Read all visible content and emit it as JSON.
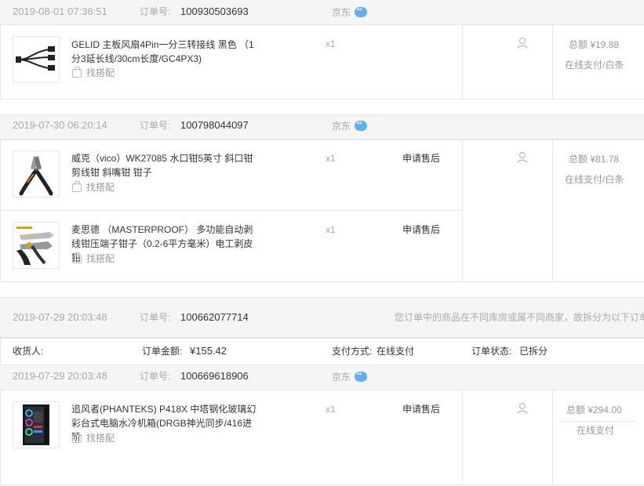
{
  "orders": [
    {
      "date": "2019-08-01 07:36:51",
      "order_no_label": "订单号:",
      "order_no": "100930503693",
      "shop": "京东",
      "total": "总额 ¥19.88",
      "pay": "在线支付/白条",
      "items": [
        {
          "title": "GELID 主板风扇4Pin一分三转接线 黑色 （1分3延长线/30cm长度/GC4PX3)",
          "qty": "x1",
          "find": "找搭配",
          "after_sale": ""
        }
      ]
    },
    {
      "date": "2019-07-30 06:20:14",
      "order_no_label": "订单号:",
      "order_no": "100798044097",
      "shop": "京东",
      "total": "总额 ¥81.78",
      "pay": "在线支付/白条",
      "items": [
        {
          "title": "威克（vico）WK27085 水口钳5英寸 斜口钳 剪线钳 斜嘴钳 钳子",
          "qty": "x1",
          "find": "找搭配",
          "after_sale": "申请售后"
        },
        {
          "title": "麦思德 （MASTERPROOF） 多功能自动剥线钳压端子钳子（0.2-6平方毫米）电工剥皮钳",
          "qty": "x1",
          "find": "找搭配",
          "after_sale": "申请售后"
        }
      ]
    }
  ],
  "split_order": {
    "date": "2019-07-29 20:03:48",
    "order_no_label": "订单号:",
    "order_no": "100662077714",
    "notice": "您订单中的商品在不同库房或属不同商家，故拆分为以下订单",
    "receiver_label": "收货人:",
    "amount_label": "订单金额:",
    "amount": "¥155.42",
    "pay_label": "支付方式:",
    "pay_value": "在线支付",
    "status_label": "订单状态:",
    "status_value": "已拆分",
    "sub": {
      "date": "2019-07-29 20:03:48",
      "order_no_label": "订单号:",
      "order_no": "100669618906",
      "shop": "京东",
      "total": "总额 ¥294.00",
      "pay": "在线支付",
      "items": [
        {
          "title": "追风者(PHANTEKS) P418X 中塔钢化玻璃幻彩台式电脑水冷机箱(DRGB神光同步/416进阶",
          "qty": "x1",
          "find": "找搭配",
          "after_sale": "申请售后"
        }
      ]
    }
  },
  "colors": {
    "header_bg": "#f5f5f5",
    "border": "#e5e5e5",
    "chat_icon": "#5eb0f5"
  },
  "icons": [
    "chat-bubble-icon",
    "user-icon",
    "find-match-icon"
  ]
}
